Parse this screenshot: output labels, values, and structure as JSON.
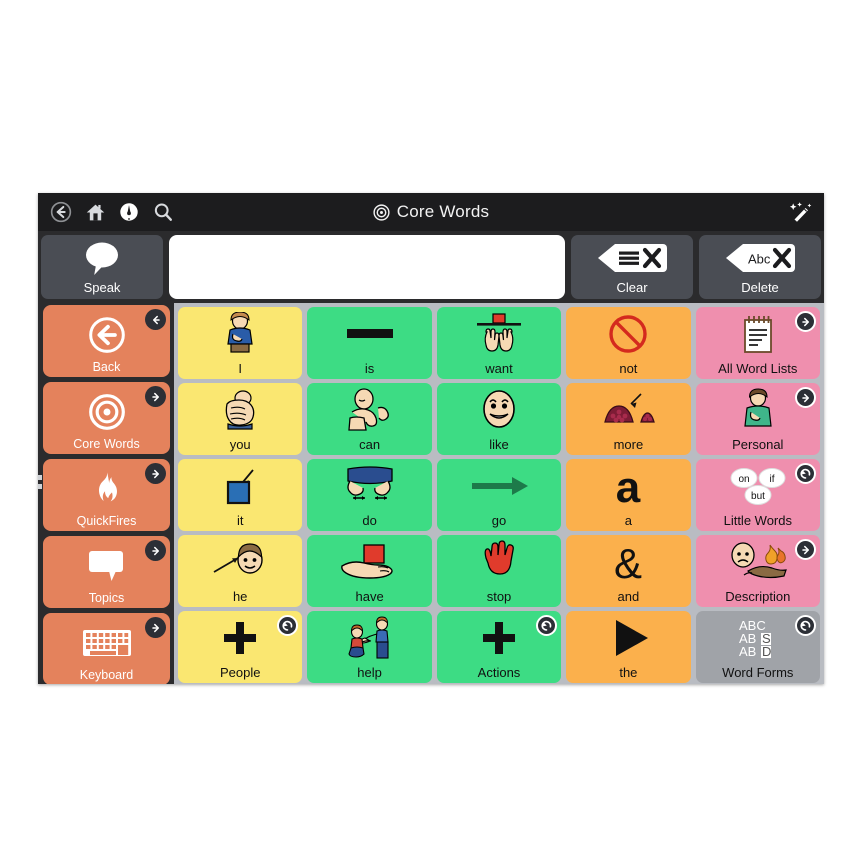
{
  "app": {
    "title": "Core Words",
    "title_icon": "target-icon"
  },
  "topbar": {
    "nav_icons": [
      {
        "name": "back-icon",
        "label": "Back"
      },
      {
        "name": "home-icon",
        "label": "Home"
      },
      {
        "name": "compass-icon",
        "label": "Navigate"
      },
      {
        "name": "search-icon",
        "label": "Search"
      }
    ],
    "right_icon": {
      "name": "magic-wand-icon",
      "label": "Edit"
    }
  },
  "message_bar": {
    "speak_label": "Speak",
    "speak_icon": "speech-bubble-icon",
    "input_value": "",
    "input_placeholder": "",
    "clear_label": "Clear",
    "clear_icon": "clear-message-icon",
    "delete_label": "Delete",
    "delete_icon": "delete-word-icon"
  },
  "sidebar": {
    "background": "#2b2b2d",
    "button_color": "#e4825c",
    "items": [
      {
        "label": "Back",
        "icon": "back-arrow-circle-icon",
        "badge": "arrow-left"
      },
      {
        "label": "Core Words",
        "icon": "target-icon",
        "badge": "arrow-right"
      },
      {
        "label": "QuickFires",
        "icon": "flame-icon",
        "badge": "arrow-right"
      },
      {
        "label": "Topics",
        "icon": "speech-bubble-icon",
        "badge": "arrow-right"
      },
      {
        "label": "Keyboard",
        "icon": "keyboard-icon",
        "badge": "arrow-right"
      }
    ]
  },
  "colors": {
    "yellow": "#fae771",
    "green": "#3ddc84",
    "orange": "#fbb04c",
    "pink": "#ef8fae",
    "gray": "#a0a3a8",
    "grid_background": "#b9bcc2",
    "dark": "#2b2b2d"
  },
  "grid": {
    "columns": 5,
    "rows": 5,
    "cells": [
      {
        "label": "I",
        "color": "yellow",
        "icon": "person-pointing-self-icon",
        "badge": null
      },
      {
        "label": "is",
        "color": "green",
        "icon": "bar-icon",
        "badge": null
      },
      {
        "label": "want",
        "color": "green",
        "icon": "hands-reaching-icon",
        "badge": null
      },
      {
        "label": "not",
        "color": "orange",
        "icon": "prohibition-icon",
        "badge": null
      },
      {
        "label": "All Word Lists",
        "color": "pink",
        "icon": "notepad-icon",
        "badge": "arrow-right"
      },
      {
        "label": "you",
        "color": "yellow",
        "icon": "pointing-hand-icon",
        "badge": null
      },
      {
        "label": "can",
        "color": "green",
        "icon": "flexing-arm-icon",
        "badge": null
      },
      {
        "label": "more",
        "color": "orange",
        "icon": "pile-icon",
        "badge": null
      },
      {
        "label": "like",
        "color": "green",
        "icon": "smiling-face-icon",
        "badge": null
      },
      {
        "label": "Personal",
        "color": "pink",
        "icon": "person-icon",
        "badge": "arrow-right"
      },
      {
        "label": "it",
        "color": "yellow",
        "icon": "blue-square-arrow-icon",
        "badge": null
      },
      {
        "label": "do",
        "color": "green",
        "icon": "hands-working-icon",
        "badge": null
      },
      {
        "label": "go",
        "color": "green",
        "icon": "right-arrow-icon",
        "badge": null
      },
      {
        "label": "a",
        "color": "orange",
        "icon": "letter-a-icon",
        "badge": null
      },
      {
        "label": "Little Words",
        "color": "pink",
        "icon": "little-words-bubbles-icon",
        "badge": "arrow-back"
      },
      {
        "label": "he",
        "color": "yellow",
        "icon": "boy-face-arrow-icon",
        "badge": null
      },
      {
        "label": "have",
        "color": "green",
        "icon": "hand-holding-block-icon",
        "badge": null
      },
      {
        "label": "stop",
        "color": "green",
        "icon": "red-hand-icon",
        "badge": null
      },
      {
        "label": "and",
        "color": "orange",
        "icon": "ampersand-icon",
        "badge": null
      },
      {
        "label": "Description",
        "color": "pink",
        "icon": "face-and-fire-icon",
        "badge": "arrow-right"
      },
      {
        "label": "People",
        "color": "yellow",
        "icon": "plus-icon",
        "badge": "arrow-back"
      },
      {
        "label": "help",
        "color": "green",
        "icon": "helping-people-icon",
        "badge": null
      },
      {
        "label": "Actions",
        "color": "green",
        "icon": "plus-icon",
        "badge": "arrow-back"
      },
      {
        "label": "the",
        "color": "orange",
        "icon": "play-triangle-icon",
        "badge": null
      },
      {
        "label": "Word Forms",
        "color": "gray",
        "icon": "abc-stack-icon",
        "badge": "arrow-back"
      }
    ],
    "little_words_bubbles": [
      "on",
      "if",
      "but"
    ],
    "word_forms_lines": [
      "ABC",
      "ABS",
      "ABD"
    ]
  }
}
